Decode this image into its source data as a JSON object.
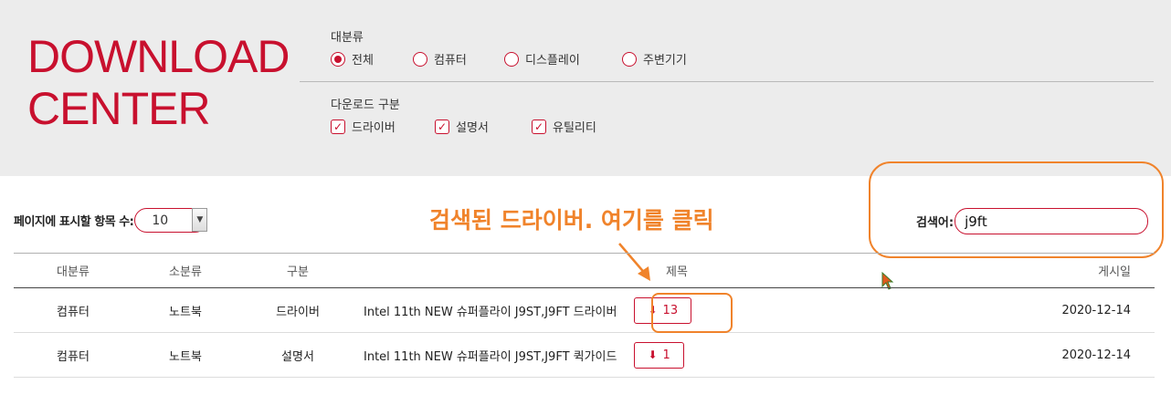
{
  "header": {
    "title_line1": "DOWNLOAD",
    "title_line2": "CENTER"
  },
  "filters": {
    "category_label": "대분류",
    "categories": [
      {
        "label": "전체",
        "selected": true
      },
      {
        "label": "컴퓨터",
        "selected": false
      },
      {
        "label": "디스플레이",
        "selected": false
      },
      {
        "label": "주변기기",
        "selected": false
      }
    ],
    "type_label": "다운로드 구분",
    "types": [
      {
        "label": "드라이버",
        "checked": true
      },
      {
        "label": "설명서",
        "checked": true
      },
      {
        "label": "유틸리티",
        "checked": true
      }
    ]
  },
  "controls": {
    "per_page_label": "페이지에 표시할 항목 수:",
    "per_page_value": "10",
    "search_label": "검색어:",
    "search_value": "j9ft"
  },
  "annotation": {
    "text": "검색된 드라이버. 여기를 클릭",
    "color": "#f0832b"
  },
  "table": {
    "headers": [
      "대분류",
      "소분류",
      "구분",
      "제목",
      "게시일"
    ],
    "rows": [
      {
        "category": "컴퓨터",
        "subcategory": "노트북",
        "type": "드라이버",
        "title": "Intel 11th NEW 슈퍼플라이 J9ST,J9FT 드라이버",
        "downloads": "13",
        "date": "2020-12-14"
      },
      {
        "category": "컴퓨터",
        "subcategory": "노트북",
        "type": "설명서",
        "title": "Intel 11th NEW 슈퍼플라이 J9ST,J9FT 퀵가이드",
        "downloads": "1",
        "date": "2020-12-14"
      }
    ]
  },
  "colors": {
    "accent": "#c8102e",
    "panel_bg": "#ececec",
    "highlight": "#f0832b"
  }
}
